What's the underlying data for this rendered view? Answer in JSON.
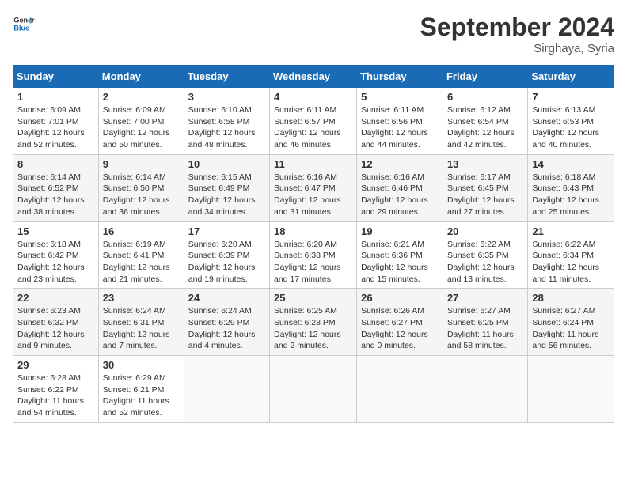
{
  "header": {
    "logo_line1": "General",
    "logo_line2": "Blue",
    "month": "September 2024",
    "location": "Sirghaya, Syria"
  },
  "weekdays": [
    "Sunday",
    "Monday",
    "Tuesday",
    "Wednesday",
    "Thursday",
    "Friday",
    "Saturday"
  ],
  "weeks": [
    [
      {
        "day": "1",
        "sunrise": "6:09 AM",
        "sunset": "7:01 PM",
        "daylight": "12 hours and 52 minutes."
      },
      {
        "day": "2",
        "sunrise": "6:09 AM",
        "sunset": "7:00 PM",
        "daylight": "12 hours and 50 minutes."
      },
      {
        "day": "3",
        "sunrise": "6:10 AM",
        "sunset": "6:58 PM",
        "daylight": "12 hours and 48 minutes."
      },
      {
        "day": "4",
        "sunrise": "6:11 AM",
        "sunset": "6:57 PM",
        "daylight": "12 hours and 46 minutes."
      },
      {
        "day": "5",
        "sunrise": "6:11 AM",
        "sunset": "6:56 PM",
        "daylight": "12 hours and 44 minutes."
      },
      {
        "day": "6",
        "sunrise": "6:12 AM",
        "sunset": "6:54 PM",
        "daylight": "12 hours and 42 minutes."
      },
      {
        "day": "7",
        "sunrise": "6:13 AM",
        "sunset": "6:53 PM",
        "daylight": "12 hours and 40 minutes."
      }
    ],
    [
      {
        "day": "8",
        "sunrise": "6:14 AM",
        "sunset": "6:52 PM",
        "daylight": "12 hours and 38 minutes."
      },
      {
        "day": "9",
        "sunrise": "6:14 AM",
        "sunset": "6:50 PM",
        "daylight": "12 hours and 36 minutes."
      },
      {
        "day": "10",
        "sunrise": "6:15 AM",
        "sunset": "6:49 PM",
        "daylight": "12 hours and 34 minutes."
      },
      {
        "day": "11",
        "sunrise": "6:16 AM",
        "sunset": "6:47 PM",
        "daylight": "12 hours and 31 minutes."
      },
      {
        "day": "12",
        "sunrise": "6:16 AM",
        "sunset": "6:46 PM",
        "daylight": "12 hours and 29 minutes."
      },
      {
        "day": "13",
        "sunrise": "6:17 AM",
        "sunset": "6:45 PM",
        "daylight": "12 hours and 27 minutes."
      },
      {
        "day": "14",
        "sunrise": "6:18 AM",
        "sunset": "6:43 PM",
        "daylight": "12 hours and 25 minutes."
      }
    ],
    [
      {
        "day": "15",
        "sunrise": "6:18 AM",
        "sunset": "6:42 PM",
        "daylight": "12 hours and 23 minutes."
      },
      {
        "day": "16",
        "sunrise": "6:19 AM",
        "sunset": "6:41 PM",
        "daylight": "12 hours and 21 minutes."
      },
      {
        "day": "17",
        "sunrise": "6:20 AM",
        "sunset": "6:39 PM",
        "daylight": "12 hours and 19 minutes."
      },
      {
        "day": "18",
        "sunrise": "6:20 AM",
        "sunset": "6:38 PM",
        "daylight": "12 hours and 17 minutes."
      },
      {
        "day": "19",
        "sunrise": "6:21 AM",
        "sunset": "6:36 PM",
        "daylight": "12 hours and 15 minutes."
      },
      {
        "day": "20",
        "sunrise": "6:22 AM",
        "sunset": "6:35 PM",
        "daylight": "12 hours and 13 minutes."
      },
      {
        "day": "21",
        "sunrise": "6:22 AM",
        "sunset": "6:34 PM",
        "daylight": "12 hours and 11 minutes."
      }
    ],
    [
      {
        "day": "22",
        "sunrise": "6:23 AM",
        "sunset": "6:32 PM",
        "daylight": "12 hours and 9 minutes."
      },
      {
        "day": "23",
        "sunrise": "6:24 AM",
        "sunset": "6:31 PM",
        "daylight": "12 hours and 7 minutes."
      },
      {
        "day": "24",
        "sunrise": "6:24 AM",
        "sunset": "6:29 PM",
        "daylight": "12 hours and 4 minutes."
      },
      {
        "day": "25",
        "sunrise": "6:25 AM",
        "sunset": "6:28 PM",
        "daylight": "12 hours and 2 minutes."
      },
      {
        "day": "26",
        "sunrise": "6:26 AM",
        "sunset": "6:27 PM",
        "daylight": "12 hours and 0 minutes."
      },
      {
        "day": "27",
        "sunrise": "6:27 AM",
        "sunset": "6:25 PM",
        "daylight": "11 hours and 58 minutes."
      },
      {
        "day": "28",
        "sunrise": "6:27 AM",
        "sunset": "6:24 PM",
        "daylight": "11 hours and 56 minutes."
      }
    ],
    [
      {
        "day": "29",
        "sunrise": "6:28 AM",
        "sunset": "6:22 PM",
        "daylight": "11 hours and 54 minutes."
      },
      {
        "day": "30",
        "sunrise": "6:29 AM",
        "sunset": "6:21 PM",
        "daylight": "11 hours and 52 minutes."
      },
      null,
      null,
      null,
      null,
      null
    ]
  ]
}
